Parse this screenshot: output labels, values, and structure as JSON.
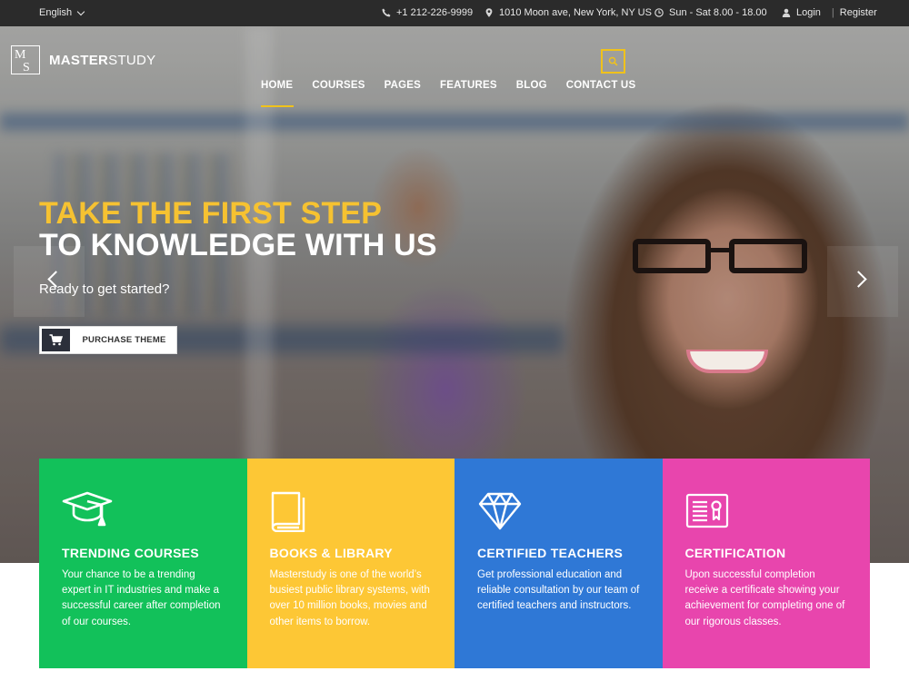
{
  "topbar": {
    "language": "English",
    "phone": "+1 212-226-9999",
    "address": "1010 Moon ave, New York, NY US",
    "hours": "Sun - Sat 8.00 - 18.00",
    "login": "Login",
    "separator": "|",
    "register": "Register"
  },
  "brand": {
    "mark_top": "M",
    "mark_bottom": "S",
    "name_bold": "MASTER",
    "name_light": "STUDY"
  },
  "nav": {
    "items": [
      {
        "label": "HOME",
        "active": true
      },
      {
        "label": "COURSES",
        "active": false
      },
      {
        "label": "PAGES",
        "active": false
      },
      {
        "label": "FEATURES",
        "active": false
      },
      {
        "label": "BLOG",
        "active": false
      },
      {
        "label": "CONTACT US",
        "active": false
      }
    ],
    "search_icon": "search-icon"
  },
  "hero": {
    "headline_line1": "TAKE THE FIRST STEP",
    "headline_line2": "TO KNOWLEDGE WITH US",
    "subline": "Ready to get started?",
    "cta_label": "PURCHASE THEME",
    "cta_icon": "cart-icon",
    "prev_icon": "chevron-left-icon",
    "next_icon": "chevron-right-icon"
  },
  "colors": {
    "accent_yellow": "#f6c231",
    "topbar_bg": "#2b2b2b",
    "green": "#12c15a",
    "yellow": "#fdc735",
    "blue": "#2f78d6",
    "pink": "#e845ad"
  },
  "features": [
    {
      "icon": "graduation-cap-icon",
      "title": "TRENDING COURSES",
      "text": "Your chance to be a trending expert in IT industries and make a successful career after completion of our courses."
    },
    {
      "icon": "book-icon",
      "title": "BOOKS & LIBRARY",
      "text": "Masterstudy is one of the world’s busiest public library systems, with over 10 million books, movies and other items to borrow."
    },
    {
      "icon": "diamond-icon",
      "title": "CERTIFIED TEACHERS",
      "text": "Get professional education and reliable consultation by our team of certified teachers and instructors."
    },
    {
      "icon": "certificate-icon",
      "title": "CERTIFICATION",
      "text": "Upon successful completion receive a certificate showing your achievement for completing one of our rigorous classes."
    }
  ]
}
